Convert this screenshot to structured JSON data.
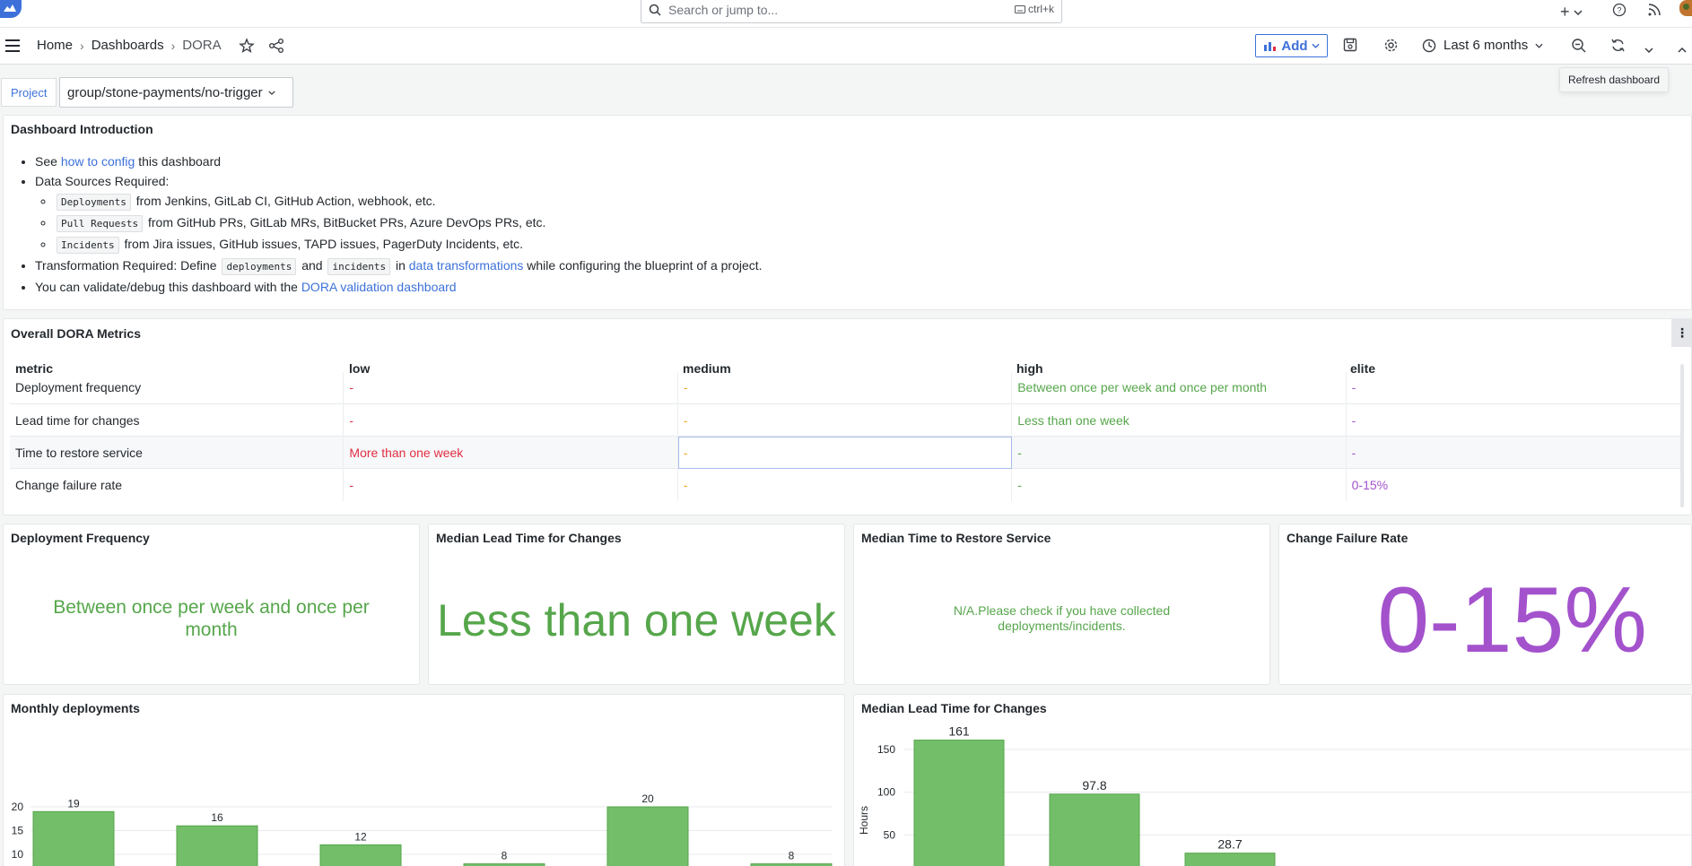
{
  "search": {
    "placeholder": "Search or jump to...",
    "shortcut": "ctrl+k"
  },
  "breadcrumb": {
    "home": "Home",
    "dashboards": "Dashboards",
    "current": "DORA"
  },
  "toolbar": {
    "add_label": "Add",
    "time_range": "Last 6 months",
    "refresh_tooltip": "Refresh dashboard"
  },
  "variable": {
    "label": "Project",
    "value": "group/stone-payments/no-trigger"
  },
  "intro": {
    "title": "Dashboard Introduction",
    "see_prefix": "See ",
    "see_link": "how to config",
    "see_suffix": " this dashboard",
    "sources_label": "Data Sources Required:",
    "sources": [
      {
        "code": "Deployments",
        "text": " from Jenkins, GitLab CI, GitHub Action, webhook, etc."
      },
      {
        "code": "Pull Requests",
        "text": " from GitHub PRs, GitLab MRs, BitBucket PRs, Azure DevOps PRs, etc."
      },
      {
        "code": "Incidents",
        "text": " from Jira issues, GitHub issues, TAPD issues, PagerDuty Incidents, etc."
      }
    ],
    "transform_prefix": "Transformation Required: Define ",
    "transform_code1": "deployments",
    "transform_and": " and ",
    "transform_code2": "incidents",
    "transform_in": " in ",
    "transform_link": "data transformations",
    "transform_suffix": " while configuring the blueprint of a project.",
    "validate_prefix": "You can validate/debug this dashboard with the ",
    "validate_link": "DORA validation dashboard"
  },
  "overall": {
    "title": "Overall DORA Metrics",
    "columns": [
      "metric",
      "low",
      "medium",
      "high",
      "elite"
    ],
    "rows": [
      [
        "Deployment frequency",
        "-",
        "-",
        "Between once per week and once per month",
        "-"
      ],
      [
        "Lead time for changes",
        "-",
        "-",
        "Less than one week",
        "-"
      ],
      [
        "Time to restore service",
        "More than one week",
        "-",
        "-",
        "-"
      ],
      [
        "Change failure rate",
        "-",
        "-",
        "-",
        "0-15%"
      ]
    ]
  },
  "stats": {
    "deploy_freq": {
      "title": "Deployment Frequency",
      "value": "Between once per week and once per month"
    },
    "lead_time": {
      "title": "Median Lead Time for Changes",
      "value": "Less than one week"
    },
    "restore": {
      "title": "Median Time to Restore Service",
      "value": "N/A.Please check if you have collected deployments/incidents."
    },
    "cfr": {
      "title": "Change Failure Rate",
      "value": "0-15%"
    }
  },
  "colors": {
    "accent": "#3d71d9",
    "green": "#56a64b",
    "purple": "#a352cc",
    "red": "#e02f44",
    "orange": "#f5a623",
    "bar": "#73bf69"
  },
  "chart_data": [
    {
      "type": "bar",
      "title": "Monthly deployments",
      "values": [
        19,
        16,
        12,
        8,
        20,
        8
      ],
      "yticks": [
        5,
        10,
        15,
        20
      ],
      "ylim": [
        0,
        22
      ],
      "ylabel": "",
      "grid": true
    },
    {
      "type": "bar",
      "title": "Median Lead Time for Changes",
      "values": [
        161,
        97.8,
        28.7
      ],
      "yticks": [
        50,
        100,
        150
      ],
      "ylim": [
        0,
        170
      ],
      "ylabel": "Hours",
      "grid": true
    }
  ]
}
